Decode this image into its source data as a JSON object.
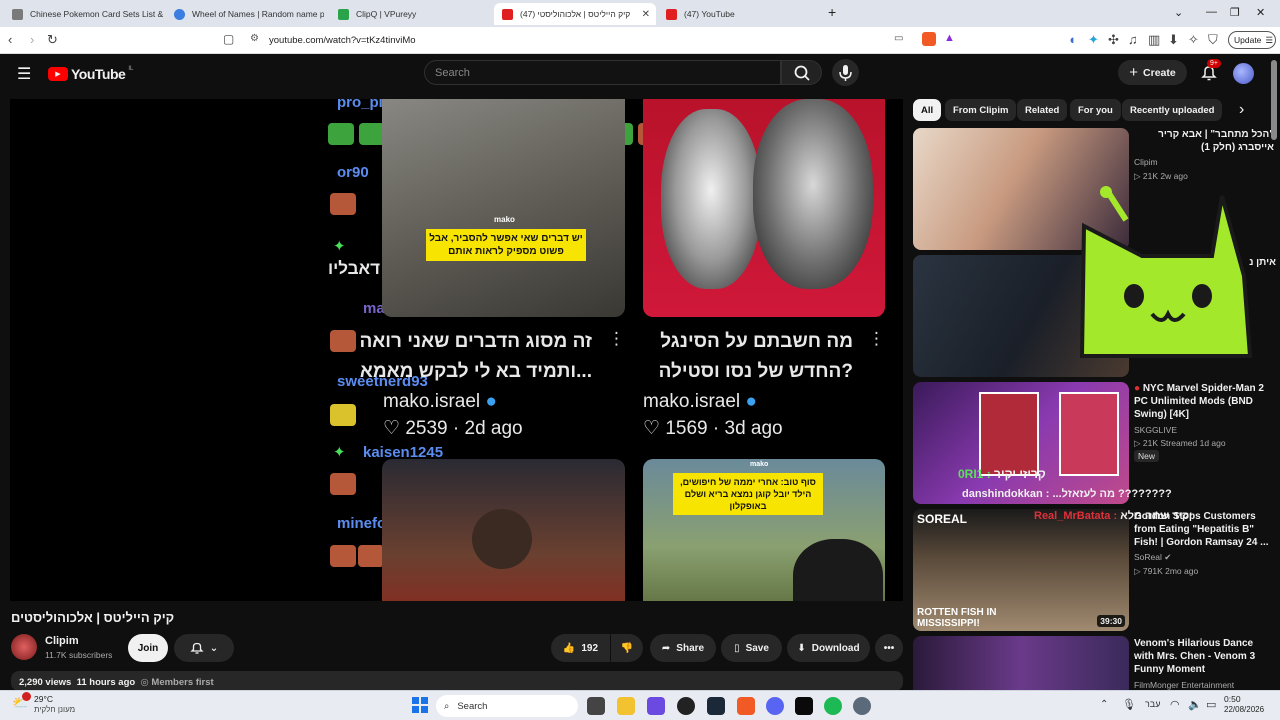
{
  "browser": {
    "tabs": [
      {
        "label": "Chinese Pokemon Card Sets List & P",
        "color": "#7a7a7a"
      },
      {
        "label": "Wheel of Names | Random name pic",
        "color": "#3b7de0"
      },
      {
        "label": "ClipQ | VPureyy",
        "color": "#2aa34a"
      },
      {
        "label": "קיק הייליטס | אלכוהוליסטי (47)",
        "color": "#e02020"
      },
      {
        "label": "(47) YouTube",
        "color": "#e02020"
      }
    ],
    "new_tab": "+",
    "url": "youtube.com/watch?v=tKz4tinviMo",
    "update_label": "Update"
  },
  "youtube": {
    "logo": "YouTube",
    "region": "IL",
    "search_placeholder": "Search",
    "create_label": "Create",
    "notification_badge": "9+"
  },
  "video_overlay": {
    "chat_names": [
      "pro_pixel12",
      "or90",
      "max32678",
      "sweetnerd93",
      "kaisen1245",
      "minefor10"
    ],
    "chat_message": "קק דאבליו",
    "card1_caption": "יש דברים שאי אפשר להסביר, אבל פשוט מספיק לראות אותם",
    "card1_brand": "mako",
    "post1": {
      "line1": "זה מסוג הדברים שאני רואה",
      "line2": "...ותמיד בא לי לבקש מאמא",
      "account": "mako.israel",
      "likes": "2539",
      "age": "2d ago"
    },
    "post2": {
      "line1": "מה חשבתם על הסינגל",
      "line2": "?החדש של נסו וסטילה",
      "account": "mako.israel",
      "likes": "1569",
      "age": "3d ago"
    },
    "card4_brand": "mako",
    "card4_caption": "סוף טוב: אחרי יממה של חיפושים, הילד יובל קוגן נמצא בריא ושלם באופקלון"
  },
  "video_info": {
    "title": "קיק הייליטס | אלכוהוליסטים",
    "channel": "Clipim",
    "subscribers": "11.7K subscribers",
    "join": "Join",
    "likes": "192",
    "share": "Share",
    "save": "Save",
    "download": "Download",
    "views": "2,290 views",
    "age": "11 hours ago",
    "members": "Members first"
  },
  "chips": [
    "All",
    "From Clipim",
    "Related",
    "For you",
    "Recently uploaded"
  ],
  "recommendations": [
    {
      "title": "\"הכל מתחבר\" | אבא קריר אייסברג (חלק 1)",
      "channel": "Clipim",
      "meta": "▷ 21K   2w ago"
    },
    {
      "title": "איתן נ",
      "channel": "",
      "meta": ""
    },
    {
      "title": "NYC Marvel Spider-Man 2 PC Unlimited Mods (BND Swing) [4K]",
      "channel": "SKGGLIVE",
      "meta": "▷ 21K   Streamed 1d ago",
      "badge": "New"
    },
    {
      "title": "Gordon Stops Customers from Eating \"Hepatitis B\" Fish! | Gordon Ramsay 24 ...",
      "channel": "SoReal",
      "meta": "▷ 791K   2mo ago",
      "duration": "39:30",
      "thumb_text": "ROTTEN FISH IN MISSISSIPPI!",
      "thumb_logo": "SOREAL"
    },
    {
      "title": "Venom's Hilarious Dance with Mrs. Chen - Venom 3 Funny Moment",
      "channel": "FilmMonger Entertainment",
      "meta": ""
    }
  ],
  "sidebar_chat": [
    {
      "name": "0RI1",
      "text": "קריזי יקיר"
    },
    {
      "name": "danshindokkan",
      "text": "...מה לעזאזל ????????"
    },
    {
      "name": "Real_MrBatata",
      "text": "יקיר שתה מלא"
    }
  ],
  "taskbar": {
    "weather_temp": "29°C",
    "weather_desc": "מעונן חלקית",
    "search_label": "Search",
    "lang": "עבר",
    "time": "0:50",
    "date": "22/08/2026"
  }
}
